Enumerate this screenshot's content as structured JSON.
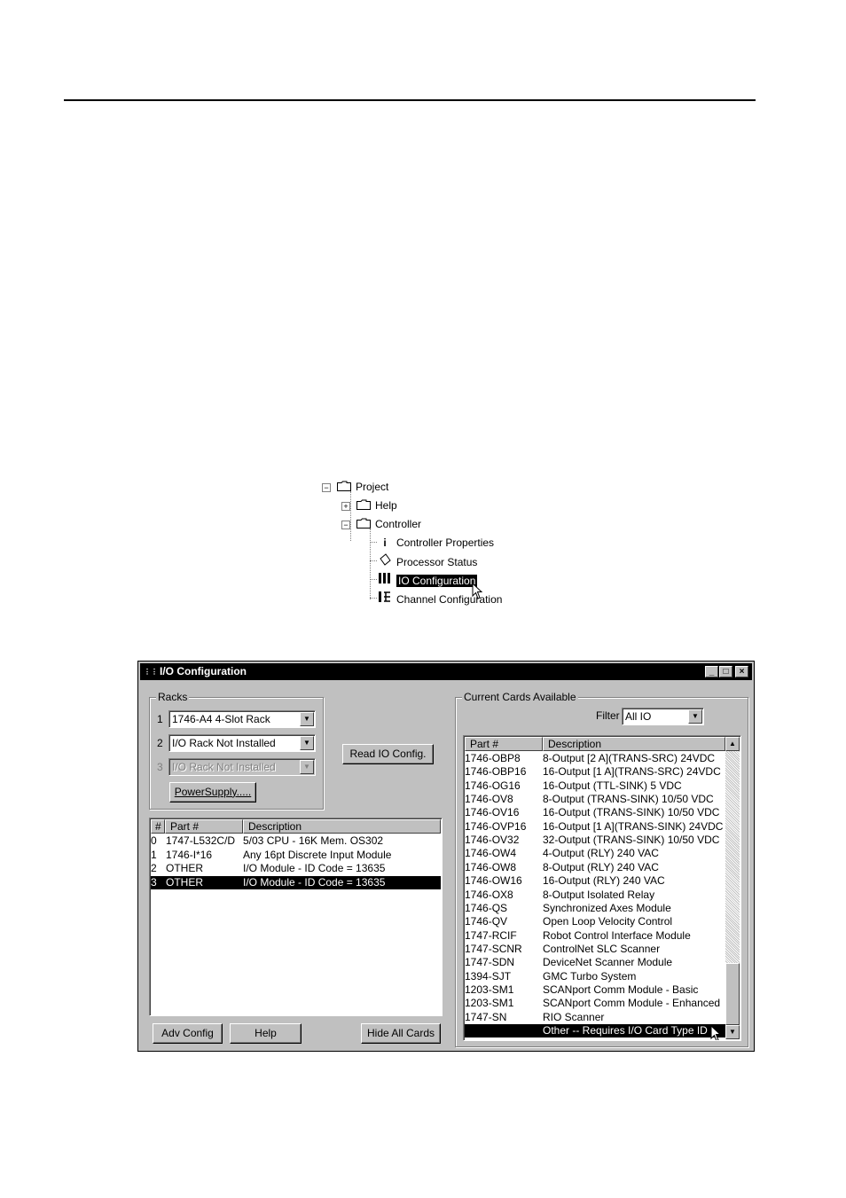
{
  "tree": {
    "items": [
      {
        "label": "Project",
        "expander": "−"
      },
      {
        "label": "Help",
        "expander": "+"
      },
      {
        "label": "Controller",
        "expander": "−"
      },
      {
        "label": "Controller Properties"
      },
      {
        "label": "Processor Status"
      },
      {
        "label": "IO Configuration"
      },
      {
        "label": "Channel Configuration"
      }
    ]
  },
  "window": {
    "title": "I/O Configuration",
    "controls": {
      "minimize": "_",
      "maximize": "□",
      "close": "×"
    },
    "racks": {
      "label": "Racks",
      "items": [
        {
          "num": "1",
          "value": "1746-A4  4-Slot Rack"
        },
        {
          "num": "2",
          "value": "I/O Rack Not Installed"
        },
        {
          "num": "3",
          "value": "I/O Rack Not Installed"
        }
      ],
      "powersupply_label": "PowerSupply....."
    },
    "read_config_label": "Read IO Config.",
    "slots": {
      "headers": [
        "#",
        "Part #",
        "Description"
      ],
      "rows": [
        {
          "num": "0",
          "part": "1747-L532C/D",
          "desc": "5/03 CPU - 16K Mem. OS302"
        },
        {
          "num": "1",
          "part": "1746-I*16",
          "desc": "Any 16pt Discrete Input Module"
        },
        {
          "num": "2",
          "part": "OTHER",
          "desc": "I/O Module - ID Code = 13635"
        },
        {
          "num": "3",
          "part": "OTHER",
          "desc": "I/O Module - ID Code = 13635"
        }
      ]
    },
    "buttons": {
      "adv_config": "Adv Config",
      "help": "Help",
      "hide_all": "Hide All Cards"
    },
    "cards": {
      "label": "Current Cards Available",
      "filter_label": "Filter",
      "filter_value": "All IO",
      "headers": [
        "Part #",
        "Description"
      ],
      "rows": [
        {
          "part": "1746-OBP8",
          "desc": "8-Output [2 A](TRANS-SRC) 24VDC"
        },
        {
          "part": "1746-OBP16",
          "desc": "16-Output [1 A](TRANS-SRC) 24VDC"
        },
        {
          "part": "1746-OG16",
          "desc": "16-Output (TTL-SINK) 5 VDC"
        },
        {
          "part": "1746-OV8",
          "desc": "8-Output (TRANS-SINK) 10/50 VDC"
        },
        {
          "part": "1746-OV16",
          "desc": "16-Output (TRANS-SINK) 10/50 VDC"
        },
        {
          "part": "1746-OVP16",
          "desc": "16-Output [1 A](TRANS-SINK) 24VDC"
        },
        {
          "part": "1746-OV32",
          "desc": "32-Output (TRANS-SINK) 10/50 VDC"
        },
        {
          "part": "1746-OW4",
          "desc": "4-Output (RLY) 240 VAC"
        },
        {
          "part": "1746-OW8",
          "desc": "8-Output (RLY) 240 VAC"
        },
        {
          "part": "1746-OW16",
          "desc": "16-Output (RLY) 240 VAC"
        },
        {
          "part": "1746-OX8",
          "desc": "8-Output Isolated Relay"
        },
        {
          "part": "1746-QS",
          "desc": "Synchronized Axes Module"
        },
        {
          "part": "1746-QV",
          "desc": "Open Loop Velocity Control"
        },
        {
          "part": "1747-RCIF",
          "desc": "Robot Control Interface Module"
        },
        {
          "part": "1747-SCNR",
          "desc": "ControlNet SLC Scanner"
        },
        {
          "part": "1747-SDN",
          "desc": "DeviceNet Scanner Module"
        },
        {
          "part": "1394-SJT",
          "desc": "GMC Turbo System"
        },
        {
          "part": "1203-SM1",
          "desc": "SCANport Comm Module - Basic"
        },
        {
          "part": "1203-SM1",
          "desc": "SCANport Comm Module - Enhanced"
        },
        {
          "part": "1747-SN",
          "desc": "RIO Scanner"
        },
        {
          "part": "",
          "desc": "Other -- Requires I/O Card Type ID"
        }
      ]
    }
  }
}
